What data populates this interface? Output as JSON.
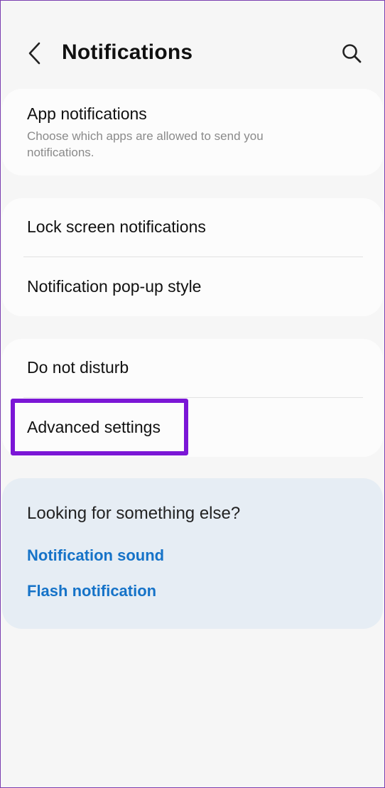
{
  "header": {
    "title": "Notifications",
    "back_icon": "chevron-left-icon",
    "search_icon": "search-icon"
  },
  "card1": {
    "title": "App notifications",
    "subtitle": "Choose which apps are allowed to send you notifications."
  },
  "card2": {
    "items": [
      {
        "label": "Lock screen notifications"
      },
      {
        "label": "Notification pop-up style"
      }
    ]
  },
  "card3": {
    "items": [
      {
        "label": "Do not disturb"
      },
      {
        "label": "Advanced settings"
      }
    ]
  },
  "suggestions": {
    "heading": "Looking for something else?",
    "links": [
      {
        "label": "Notification sound"
      },
      {
        "label": "Flash notification"
      }
    ]
  },
  "colors": {
    "background": "#f6f6f6",
    "card": "#fcfcfc",
    "suggestion_card": "#e6edf4",
    "link": "#1673c8",
    "highlight": "#7b16d6"
  }
}
